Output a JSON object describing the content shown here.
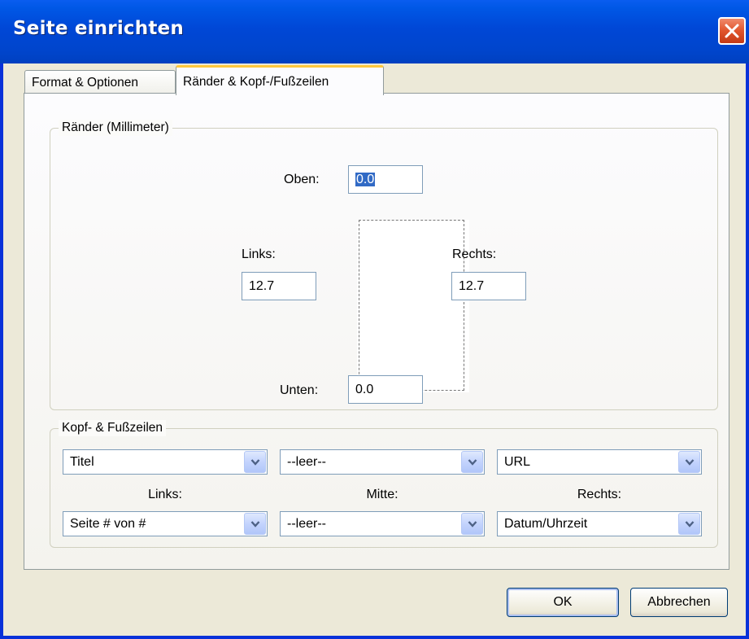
{
  "window": {
    "title": "Seite einrichten"
  },
  "tabs": [
    {
      "label": "Format & Optionen",
      "active": false
    },
    {
      "label": "Ränder & Kopf-/Fußzeilen",
      "active": true
    }
  ],
  "margins": {
    "legend": "Ränder (Millimeter)",
    "top": {
      "label": "Oben:",
      "value": "0.0"
    },
    "left": {
      "label": "Links:",
      "value": "12.7"
    },
    "right": {
      "label": "Rechts:",
      "value": "12.7"
    },
    "bottom": {
      "label": "Unten:",
      "value": "0.0"
    }
  },
  "headers_footers": {
    "legend": "Kopf- & Fußzeilen",
    "header": {
      "left": "Titel",
      "center": "--leer--",
      "right": "URL"
    },
    "labels": {
      "left": "Links:",
      "center": "Mitte:",
      "right": "Rechts:"
    },
    "footer": {
      "left": "Seite # von #",
      "center": "--leer--",
      "right": "Datum/Uhrzeit"
    }
  },
  "buttons": {
    "ok": "OK",
    "cancel": "Abbrechen"
  },
  "colors": {
    "titlebar": "#0052e0",
    "dialog_bg": "#ece9d8",
    "active_tab_accent": "#ffc83c",
    "selection": "#316ac5"
  }
}
